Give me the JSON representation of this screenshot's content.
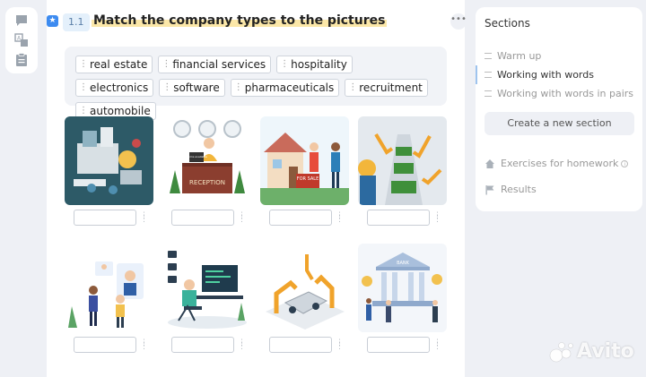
{
  "rail": {
    "icons": [
      "comment-icon",
      "translate-icon",
      "clipboard-icon"
    ]
  },
  "exercise": {
    "number": "1.1",
    "title": "Match the company types to the pictures",
    "more": "•••",
    "words": [
      "real estate",
      "financial services",
      "hospitality",
      "electronics",
      "software",
      "pharmaceuticals",
      "recruitment",
      "automobile"
    ]
  },
  "pictures": [
    {
      "name": "pharmaceutical-factory-image"
    },
    {
      "name": "hotel-reception-image",
      "sign": "RECEPTION",
      "board": "rooms available"
    },
    {
      "name": "house-for-sale-image",
      "sign": "FOR SALE"
    },
    {
      "name": "electronics-assembly-image"
    },
    {
      "name": "recruitment-candidates-image"
    },
    {
      "name": "software-developer-image"
    },
    {
      "name": "car-assembly-image"
    },
    {
      "name": "bank-building-image",
      "sign": "BANK"
    }
  ],
  "sidebar": {
    "title": "Sections",
    "items": [
      {
        "label": "Warm up",
        "active": false
      },
      {
        "label": "Working with words",
        "active": true
      },
      {
        "label": "Working with words in pairs",
        "active": false
      }
    ],
    "create_label": "Create a new section",
    "homework_label": "Exercises for homework",
    "results_label": "Results"
  },
  "watermark": "Avito",
  "colors": {
    "accent": "#3d8bf0",
    "highlight": "#fbe7a8",
    "page_bg": "#eef0f5"
  }
}
